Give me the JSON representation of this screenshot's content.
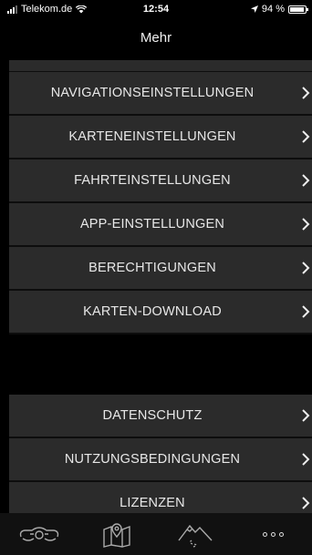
{
  "status_bar": {
    "carrier": "Telekom.de",
    "time": "12:54",
    "battery_percent": "94 %",
    "battery_level": 0.94
  },
  "header": {
    "title": "Mehr"
  },
  "menu": {
    "group1": [
      {
        "label": "NAVIGATIONSEINSTELLUNGEN"
      },
      {
        "label": "KARTENEINSTELLUNGEN"
      },
      {
        "label": "FAHRTEINSTELLUNGEN"
      },
      {
        "label": "APP-EINSTELLUNGEN"
      },
      {
        "label": "BERECHTIGUNGEN"
      },
      {
        "label": "KARTEN-DOWNLOAD"
      }
    ],
    "group2": [
      {
        "label": "DATENSCHUTZ"
      },
      {
        "label": "NUTZUNGSBEDINGUNGEN"
      },
      {
        "label": "LIZENZEN"
      }
    ]
  },
  "tab_bar": {
    "tabs": [
      {
        "icon": "motorcycle-icon"
      },
      {
        "icon": "map-pin-icon"
      },
      {
        "icon": "mountain-route-icon"
      },
      {
        "icon": "more-dots-icon"
      }
    ]
  },
  "colors": {
    "background": "#000000",
    "row": "#2b2b2b",
    "text": "#e8e8e8"
  }
}
